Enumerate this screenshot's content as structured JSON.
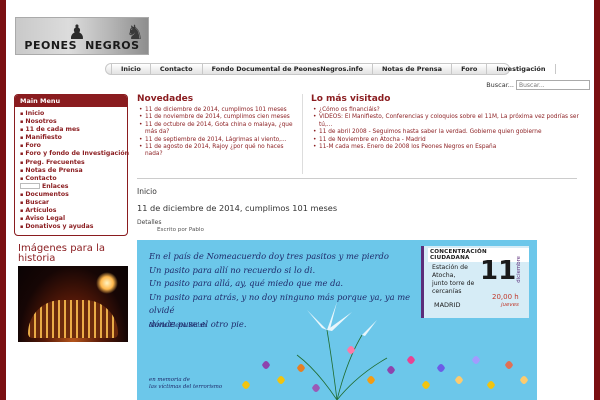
{
  "site": {
    "logo_text": "PEONES   NEGROS"
  },
  "nav": {
    "items": [
      "Inicio",
      "Contacto",
      "Fondo Documental de PeonesNegros.info",
      "Notas de Prensa",
      "Foro",
      "Investigación"
    ]
  },
  "search": {
    "label": "Buscar...",
    "placeholder": "Buscar..."
  },
  "menu": {
    "title": "Main Menu",
    "items": [
      "Inicio",
      "Nosotros",
      "11 de cada mes",
      "Manifiesto",
      "Foro",
      "Foro y fondo de Investigación",
      "Preg. Frecuentes",
      "Notas de Prensa",
      "Contacto",
      "Enlaces",
      "Documentos",
      "Buscar",
      "Artículos",
      "Aviso Legal",
      "Donativos y ayudas"
    ]
  },
  "images_heading": "Imágenes para la historia",
  "novedades": {
    "title": "Novedades",
    "items": [
      "11 de diciembre de 2014, cumplimos 101 meses",
      "11 de noviembre de 2014, cumplimos cien meses",
      "11 de octubre de 2014, Gota china o malaya, ¿que más da?",
      "11 de septiembre de 2014, Lágrimas al viento,...",
      "11 de agosto de 2014, Rajoy ¿por qué no haces nada?"
    ]
  },
  "mas_visitado": {
    "title": "Lo más visitado",
    "items": [
      "¿Cómo os financiáis?",
      "VIDEOS: El Manifiesto, Conferencias y coloquios sobre el 11M, La próxima vez podrías ser tú,...",
      "11 de abril 2008 - Seguimos hasta saber la verdad. Gobierne quien gobierne",
      "11 de Noviembre en Atocha - Madrid",
      "11-M cada mes. Enero de 2008 los Peones Negros en España"
    ]
  },
  "article": {
    "section": "Inicio",
    "title": "11 de diciembre de 2014, cumplimos 101 meses",
    "details_label": "Detalles",
    "author": "Escrito por Pablo"
  },
  "poster": {
    "poem_lines": [
      "En el país de Nomeacuerdo doy tres pasitos y me pierdo",
      "Un pasito para allí no recuerdo si lo di.",
      "Un pasito para allá, ay, qué miedo que me da.",
      "Un pasito para atrás, y no doy ninguno más porque ya, ya me olvidé",
      "dónde puse el otro pie."
    ],
    "poem_author": "María Elena Walsh",
    "memoria": [
      "en memoria de",
      "las víctimas del terrorismo"
    ],
    "event": {
      "header": "CONCENTRACIÓN CIUDADANA",
      "place": [
        "Estación de",
        "Atocha,",
        "junto torre de",
        "cercanías"
      ],
      "city": "MADRID",
      "day": "11",
      "month": "diciembre",
      "time": "20,00 h",
      "weekday": "jueves"
    }
  },
  "colors": {
    "brand": "#8a1c1f",
    "background": "#7a0f12",
    "poster_bg": "#6cc7ea"
  }
}
